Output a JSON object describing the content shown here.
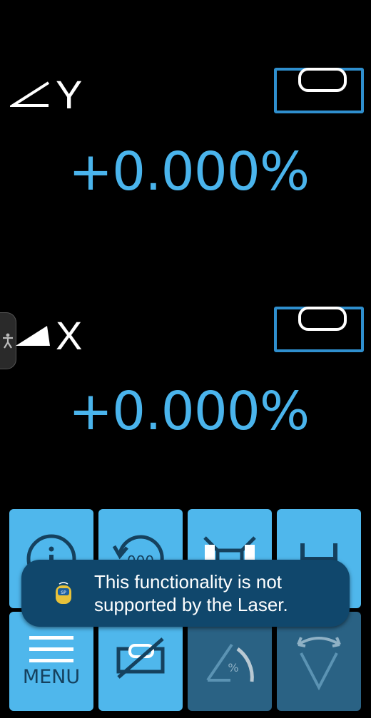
{
  "y_axis": {
    "label": "Y",
    "value": "+0.000%"
  },
  "x_axis": {
    "label": "X",
    "value": "+0.000%"
  },
  "buttons": {
    "menu_label": "MENU"
  },
  "toast": {
    "message": "This functionality is not supported by the Laser.",
    "icon": "laser-app-icon"
  },
  "colors": {
    "accent": "#4ab4ec",
    "tile": "#4fb7ec",
    "tile_disabled": "#2a6284",
    "toast_bg": "#10476c"
  }
}
